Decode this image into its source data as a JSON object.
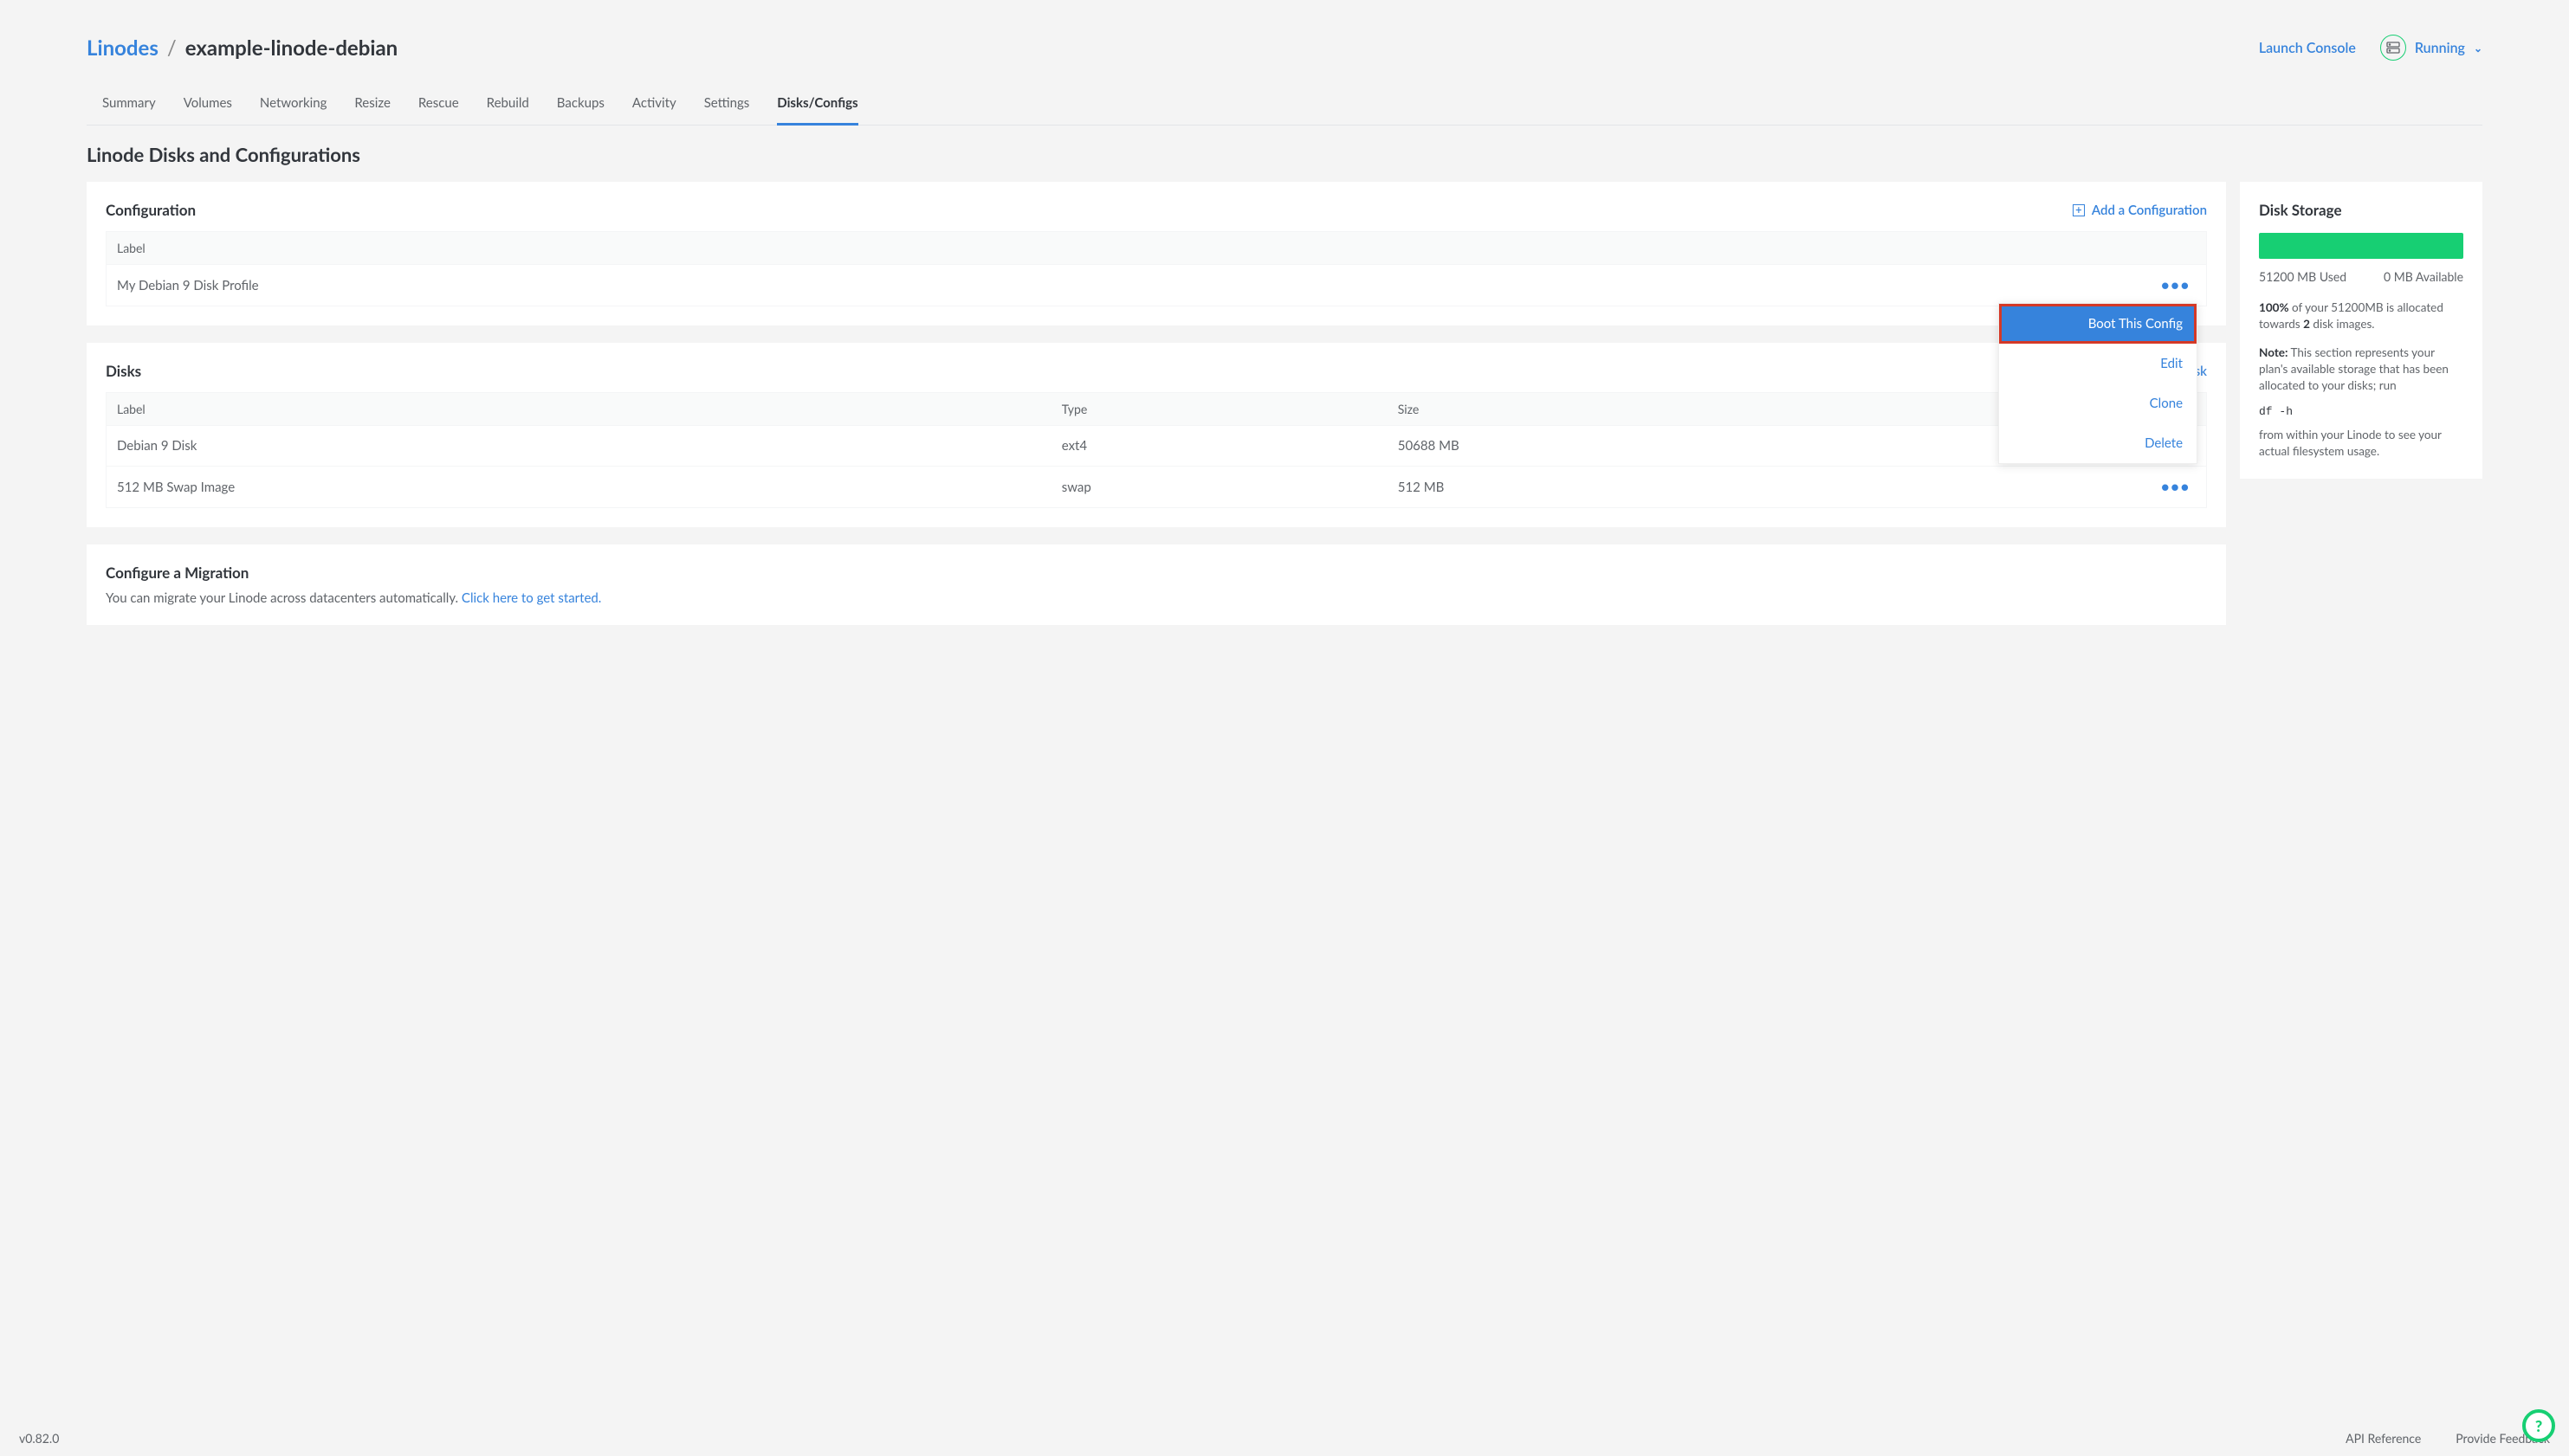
{
  "breadcrumb": {
    "parent": "Linodes",
    "current": "example-linode-debian"
  },
  "header": {
    "launch_console": "Launch Console",
    "status": "Running"
  },
  "tabs": [
    {
      "label": "Summary",
      "active": false
    },
    {
      "label": "Volumes",
      "active": false
    },
    {
      "label": "Networking",
      "active": false
    },
    {
      "label": "Resize",
      "active": false
    },
    {
      "label": "Rescue",
      "active": false
    },
    {
      "label": "Rebuild",
      "active": false
    },
    {
      "label": "Backups",
      "active": false
    },
    {
      "label": "Activity",
      "active": false
    },
    {
      "label": "Settings",
      "active": false
    },
    {
      "label": "Disks/Configs",
      "active": true
    }
  ],
  "section_title": "Linode Disks and Configurations",
  "configuration": {
    "title": "Configuration",
    "add_label": "Add a Configuration",
    "columns": {
      "label": "Label"
    },
    "rows": [
      {
        "label": "My Debian 9 Disk Profile"
      }
    ],
    "menu": [
      {
        "label": "Boot This Config",
        "highlight": true
      },
      {
        "label": "Edit",
        "highlight": false
      },
      {
        "label": "Clone",
        "highlight": false
      },
      {
        "label": "Delete",
        "highlight": false
      }
    ]
  },
  "disks": {
    "title": "Disks",
    "add_label": "sk",
    "columns": {
      "label": "Label",
      "type": "Type",
      "size": "Size"
    },
    "rows": [
      {
        "label": "Debian 9 Disk",
        "type": "ext4",
        "size": "50688 MB"
      },
      {
        "label": "512 MB Swap Image",
        "type": "swap",
        "size": "512 MB"
      }
    ]
  },
  "storage": {
    "title": "Disk Storage",
    "used": "51200 MB Used",
    "available": "0 MB Available",
    "alloc_pct": "100%",
    "alloc_line1_mid": " of your 51200MB is allocated towards ",
    "alloc_count": "2",
    "alloc_line1_end": " disk images.",
    "note_label": "Note:",
    "note_body": "  This section represents your plan's available storage that has been allocated to your disks; run",
    "command": "df -h",
    "note_tail": "from within your Linode to see your actual filesystem usage."
  },
  "migration": {
    "title": "Configure a Migration",
    "prefix": "You can migrate your Linode across datacenters automatically. ",
    "link": "Click here to get started."
  },
  "footer": {
    "version": "v0.82.0",
    "api_ref": "API Reference",
    "feedback": "Provide Feedback"
  }
}
